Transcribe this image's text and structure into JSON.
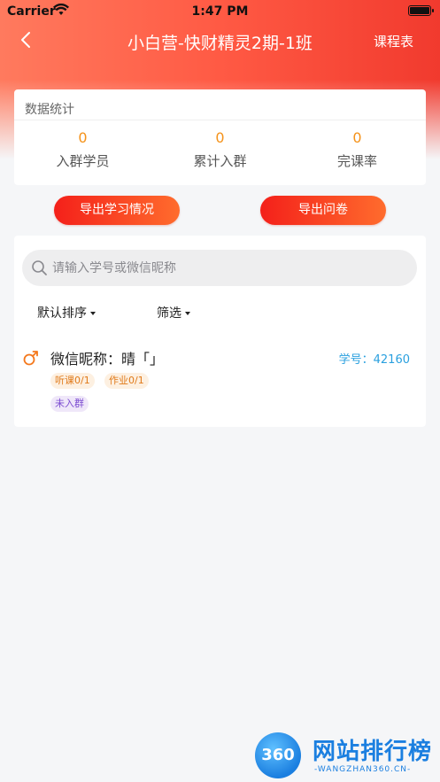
{
  "statusbar": {
    "carrier": "Carrier",
    "time": "1:47 PM"
  },
  "nav": {
    "title": "小白营-快财精灵2期-1班",
    "right_label": "课程表"
  },
  "stats": {
    "title": "数据统计",
    "items": [
      {
        "value": "0",
        "label": "入群学员"
      },
      {
        "value": "0",
        "label": "累计入群"
      },
      {
        "value": "0",
        "label": "完课率"
      }
    ]
  },
  "actions": {
    "export_study": "导出学习情况",
    "export_survey": "导出问卷"
  },
  "search": {
    "placeholder": "请输入学号或微信昵称"
  },
  "filters": {
    "sort": "默认排序",
    "screen": "筛选"
  },
  "students": [
    {
      "nickname": "微信昵称：晴「」",
      "student_id": "学号：42160",
      "tags": {
        "listen": "听课0/1",
        "work": "作业0/1",
        "group": "未入群"
      }
    }
  ],
  "colors": {
    "accent": "#f4201a",
    "value_orange": "#f59219",
    "id_blue": "#2aa0df"
  },
  "watermark": {
    "badge": "360",
    "text": "网站排行榜",
    "sub": "-WANGZHAN360.CN-"
  }
}
